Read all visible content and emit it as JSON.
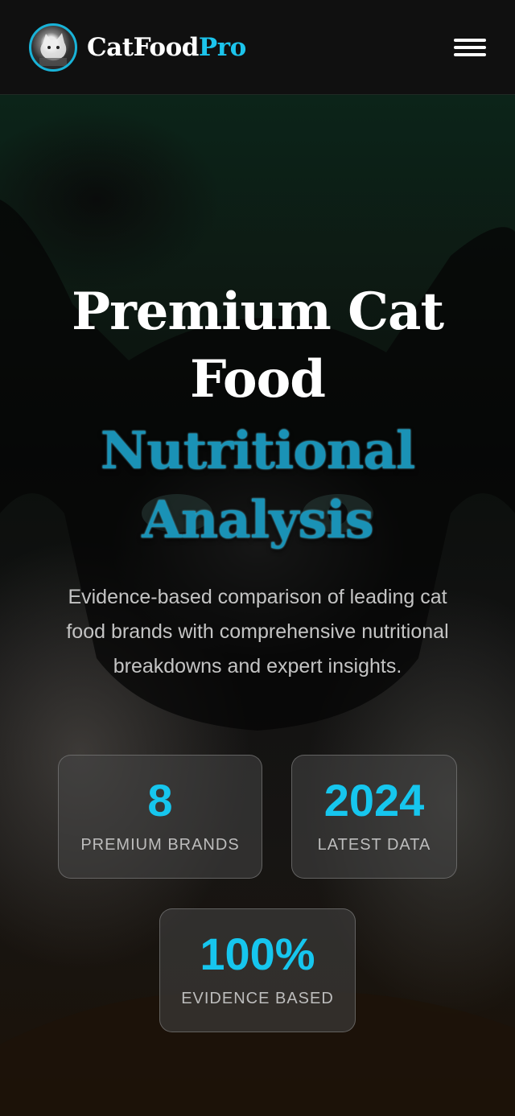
{
  "header": {
    "brand_part1": "CatFood",
    "brand_part2": "Pro",
    "logo_icon": "cat-logo-icon",
    "menu_icon": "hamburger-menu-icon"
  },
  "hero": {
    "title_line1": "Premium Cat",
    "title_line2": "Food",
    "accent_line1": "Nutritional",
    "accent_line2": "Analysis",
    "subtitle": "Evidence-based comparison of leading cat food brands with comprehensive nutritional breakdowns and expert insights."
  },
  "stats": [
    {
      "value": "8",
      "label": "PREMIUM BRANDS"
    },
    {
      "value": "2024",
      "label": "LATEST DATA"
    },
    {
      "value": "100%",
      "label": "EVIDENCE BASED"
    }
  ],
  "colors": {
    "accent": "#1cc4ec",
    "header_bg": "#101010",
    "stat_value": "#16c6ee"
  }
}
